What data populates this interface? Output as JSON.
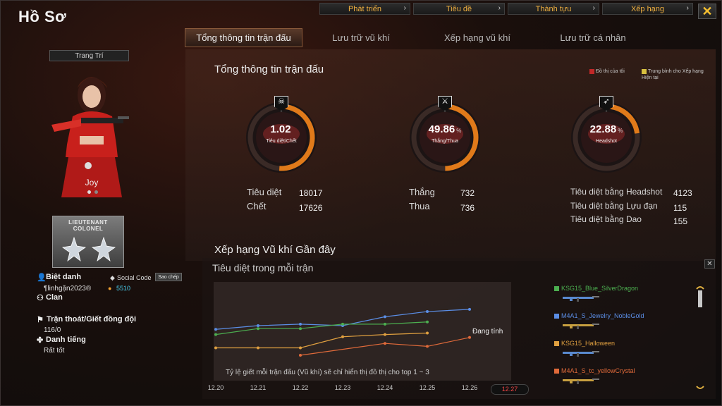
{
  "app_title": "Hồ Sơ",
  "topnav": [
    {
      "label": "Phát triển"
    },
    {
      "label": "Tiêu đề"
    },
    {
      "label": "Thành tựu"
    },
    {
      "label": "Xếp hạng"
    }
  ],
  "close_icon": "close-icon",
  "tabs": [
    {
      "label": "Tổng thông tin trận đấu",
      "active": true
    },
    {
      "label": "Lưu trữ vũ khí",
      "active": false
    },
    {
      "label": "Xếp hạng vũ khí",
      "active": false
    },
    {
      "label": "Lưu trữ cá nhân",
      "active": false
    }
  ],
  "profile": {
    "decor_label": "Trang Trí",
    "character_name": "Joy",
    "rank_text_line1": "LIEUTENANT",
    "rank_text_line2": "COLONEL",
    "nickname_label": "Biệt danh",
    "social_code_label": "Social Code",
    "copy_label": "Sao chép",
    "nickname_value": "¶linhgặn2023®",
    "social_code_value": "5510",
    "clan_label": "Clan",
    "escape_label": "Trận thoát/Giết đồng đội",
    "escape_value": "116/0",
    "reputation_label": "Danh tiếng",
    "reputation_value": "Rất tốt"
  },
  "stats": {
    "section_title": "Tổng thông tin trận đấu",
    "legend_mine": "Đồ thị của tôi",
    "legend_avg": "Trung bình cho Xếp hạng Hiện tại",
    "gauges": [
      {
        "value": "1.02",
        "pct": "",
        "caption": "Tiêu diệt/Chết",
        "fill": 0.51,
        "icon": "skull-icon"
      },
      {
        "value": "49.86",
        "pct": "%",
        "caption": "Thắng/Thua",
        "fill": 0.4986,
        "icon": "crossed-swords-icon"
      },
      {
        "value": "22.88",
        "pct": "%",
        "caption": "Headshot",
        "fill": 0.2288,
        "icon": "rifle-icon"
      }
    ],
    "kill_label": "Tiêu diệt",
    "kill_value": "18017",
    "death_label": "Chết",
    "death_value": "17626",
    "win_label": "Thắng",
    "win_value": "732",
    "lose_label": "Thua",
    "lose_value": "736",
    "hs_kill_label": "Tiêu diệt bằng Headshot",
    "hs_kill_value": "4123",
    "grenade_label": "Tiêu diệt bằng Lựu đạn",
    "grenade_value": "115",
    "knife_label": "Tiêu diệt bằng Dao",
    "knife_value": "155"
  },
  "weapon_rank": {
    "section_title": "Xếp hạng Vũ khí Gần đây",
    "subtitle": "Tiêu diệt trong mỗi trận",
    "note": "Tỷ lệ giết mỗi trận đấu (Vũ khí) sẽ chỉ hiển thị đồ thị cho top 1 ~ 3",
    "status": "Đang tính",
    "current_date": "12.27",
    "weapons": [
      {
        "name": "KSG15_Blue_SilverDragon",
        "color": "#4caf50"
      },
      {
        "name": "M4A1_S_Jewelry_NobleGold",
        "color": "#5b8ee6"
      },
      {
        "name": "KSG15_Halloween",
        "color": "#e0a040"
      },
      {
        "name": "M4A1_S_tc_yellowCrystal",
        "color": "#e06a3a"
      }
    ]
  },
  "chart_data": {
    "type": "line",
    "title": "Tiêu diệt trong mỗi trận",
    "x": [
      "12.20",
      "12.21",
      "12.22",
      "12.23",
      "12.24",
      "12.25",
      "12.26"
    ],
    "ylim": [
      0,
      1
    ],
    "series": [
      {
        "name": "M4A1_S_Jewelry_NobleGold",
        "color": "#5b8ee6",
        "values": [
          0.55,
          0.6,
          0.62,
          0.6,
          0.72,
          0.79,
          0.82
        ]
      },
      {
        "name": "KSG15_Blue_SilverDragon",
        "color": "#4caf50",
        "values": [
          0.48,
          0.56,
          0.56,
          0.62,
          0.62,
          0.65,
          null
        ]
      },
      {
        "name": "KSG15_Halloween",
        "color": "#e0a040",
        "values": [
          0.3,
          0.3,
          0.3,
          0.45,
          0.48,
          0.5,
          null
        ]
      },
      {
        "name": "M4A1_S_tc_yellowCrystal",
        "color": "#e06a3a",
        "values": [
          null,
          null,
          0.2,
          null,
          0.36,
          0.32,
          0.44
        ]
      }
    ],
    "grid": false,
    "legend": "right"
  }
}
